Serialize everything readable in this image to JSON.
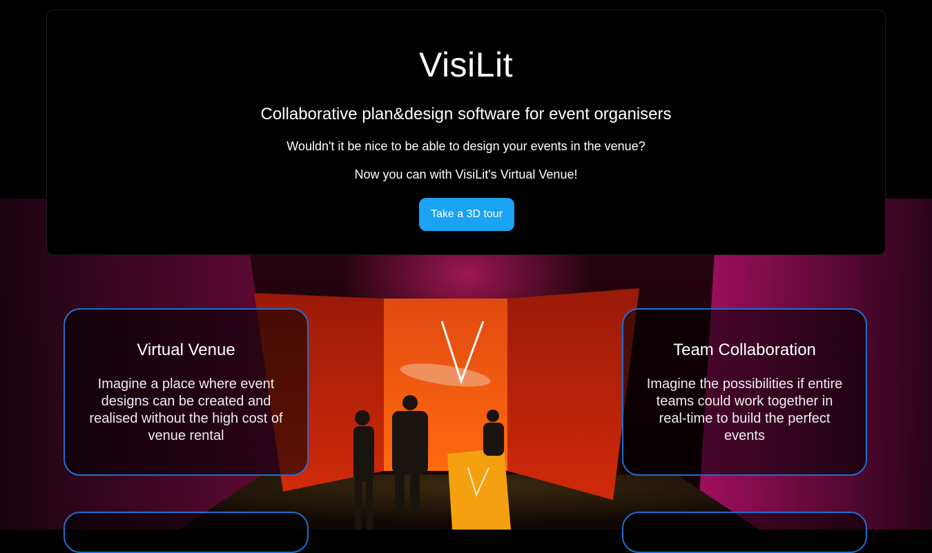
{
  "hero": {
    "title": "VisiLit",
    "subtitle": "Collaborative plan&design software for event organisers",
    "question": "Wouldn't it be nice to be able to design your events in the venue?",
    "tagline": "Now you can with VisiLit's Virtual Venue!",
    "cta_label": "Take a 3D tour"
  },
  "features": [
    {
      "title": "Virtual Venue",
      "text": "Imagine a place where event designs can be created and realised without the high cost of venue rental"
    },
    {
      "title": "Team Collaboration",
      "text": "Imagine the possibilities if entire teams could work together in real-time to build the perfect events"
    }
  ],
  "colors": {
    "accent": "#1aa3f2",
    "card_border": "#1d6fcf",
    "stage_magenta": "#c0106a",
    "stage_red": "#e02a10",
    "podium": "#f5a010"
  }
}
